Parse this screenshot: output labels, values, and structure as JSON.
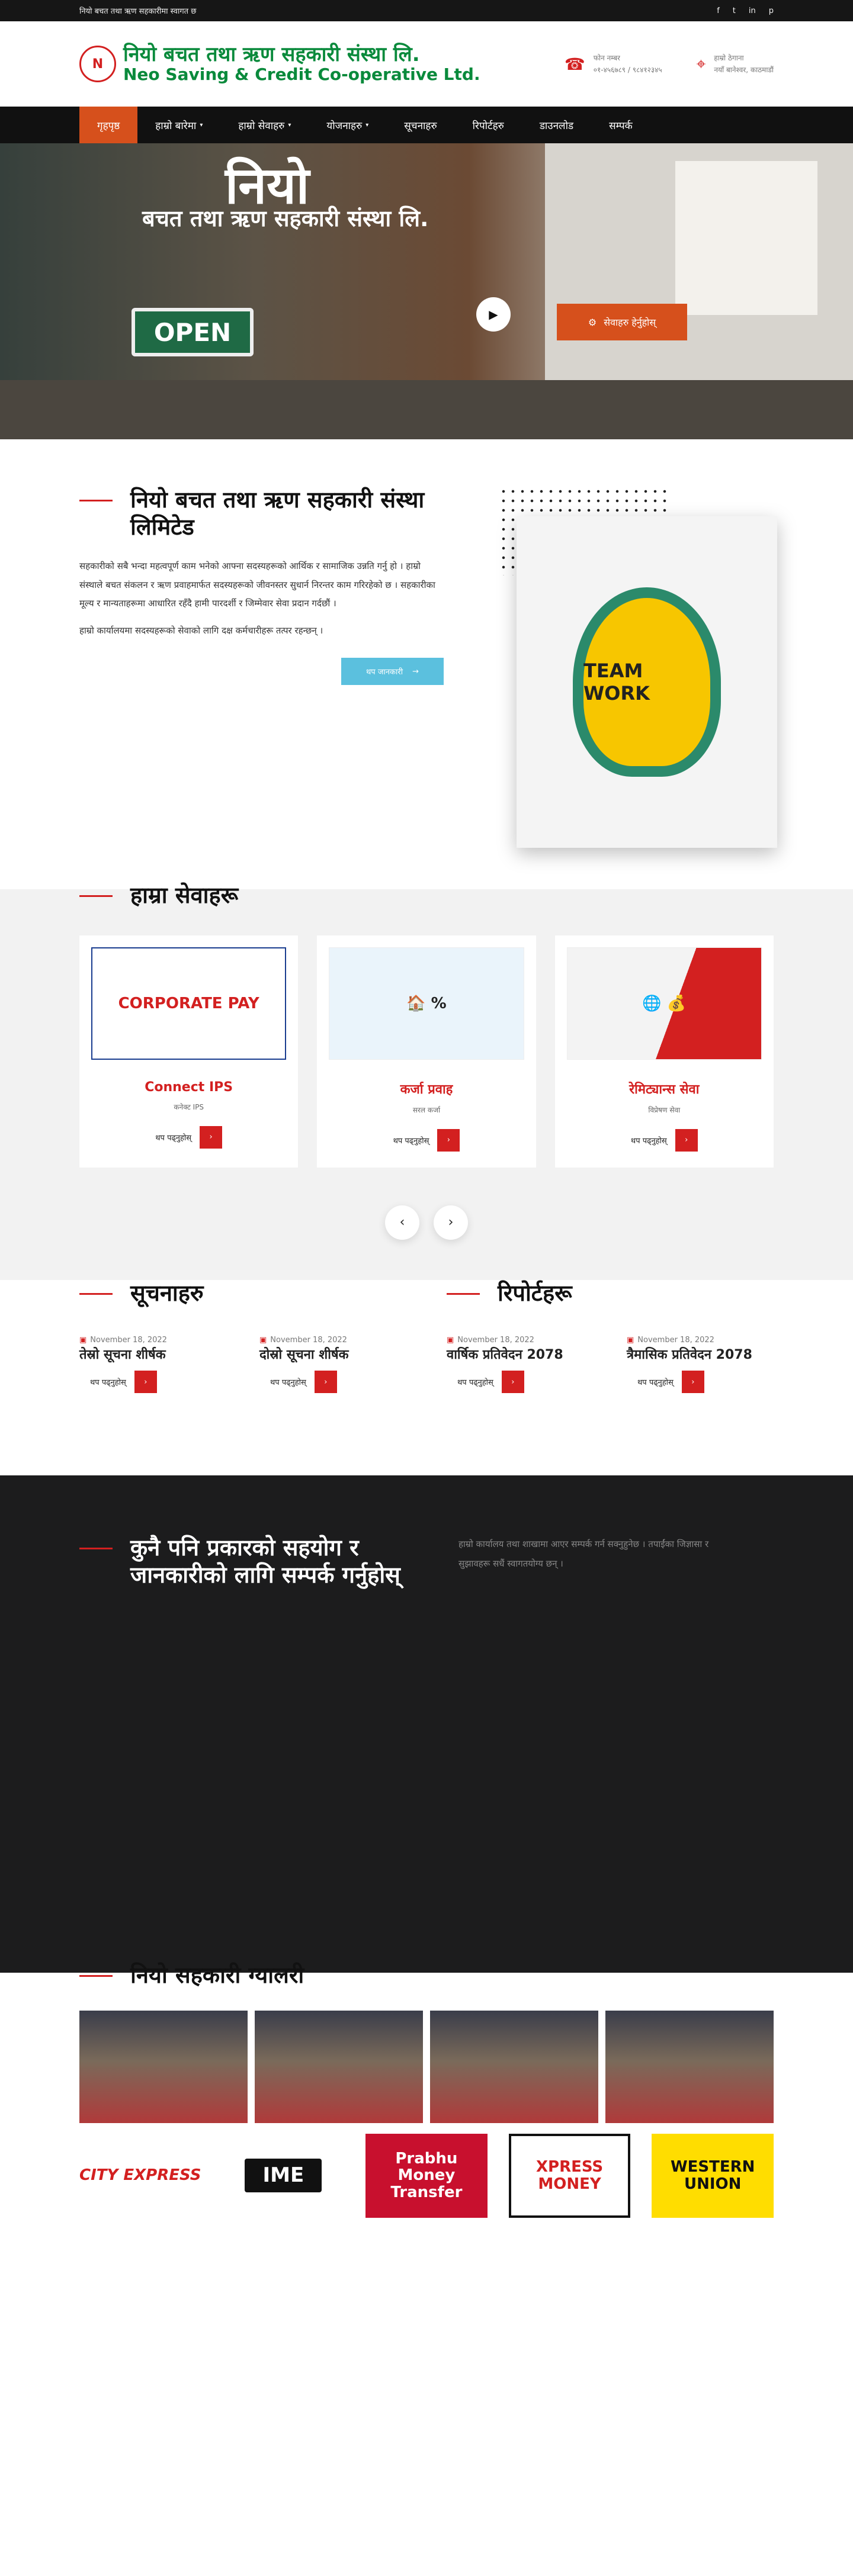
{
  "topbar": {
    "text": "नियो बचत तथा ऋण सहकारीमा स्वागत छ",
    "social": [
      "f",
      "t",
      "in",
      "p"
    ]
  },
  "logo": {
    "mark": "N",
    "line1": "नियो बचत तथा ऋण सहकारी संस्था लि.",
    "line2": "Neo Saving & Credit Co-operative Ltd."
  },
  "contacts": [
    {
      "icon": "phone-icon",
      "glyph": "☎",
      "line1": "फोन नम्बर",
      "line2": "०१-४५६७८९ / ९८४१२३४५"
    },
    {
      "icon": "location-icon",
      "glyph": "⌖",
      "line1": "हाम्रो ठेगाना",
      "line2": "नयाँ बानेश्वर, काठमाडौं"
    }
  ],
  "nav": [
    {
      "label": "गृहपृष्ठ",
      "active": true,
      "caret": ""
    },
    {
      "label": "हाम्रो बारेमा",
      "active": false,
      "caret": "▾"
    },
    {
      "label": "हाम्रो सेवाहरु",
      "active": false,
      "caret": "▾"
    },
    {
      "label": "योजनाहरु",
      "active": false,
      "caret": "▾"
    },
    {
      "label": "सूचनाहरु",
      "active": false,
      "caret": ""
    },
    {
      "label": "रिपोर्टहरु",
      "active": false,
      "caret": ""
    },
    {
      "label": "डाउनलोड",
      "active": false,
      "caret": ""
    },
    {
      "label": "सम्पर्क",
      "active": false,
      "caret": ""
    }
  ],
  "hero": {
    "sign": "नियो",
    "sign2": "बचत तथा ऋण सहकारी संस्था लि.",
    "open": "OPEN",
    "play": "▶",
    "button": "सेवाहरु हेर्नुहोस्",
    "button_icon": "⚙"
  },
  "about": {
    "title": "नियो बचत तथा ऋण सहकारी संस्था लिमिटेड",
    "p1": "सहकारीको सबै भन्दा महत्वपूर्ण काम भनेको आफ्ना सदस्यहरूको आर्थिक र सामाजिक उन्नति गर्नु हो । हाम्रो संस्थाले बचत संकलन र ऋण प्रवाहमार्फत सदस्यहरूको जीवनस्तर सुधार्न निरन्तर काम गरिरहेको छ । सहकारीका मूल्य र मान्यताहरूमा आधारित रहँदै हामी पारदर्शी र जिम्मेवार सेवा प्रदान गर्दछौं ।",
    "p2": "हाम्रो कार्यालयमा सदस्यहरूको सेवाको लागि दक्ष कर्मचारीहरू तत्पर रहन्छन् ।",
    "button": "थप जानकारी",
    "button_icon": "→",
    "image_text": "TEAM WORK"
  },
  "services": {
    "title": "हाम्रा सेवाहरू",
    "items": [
      {
        "name": "Connect IPS",
        "sub": "कनेक्ट IPS",
        "pic": "CORPORATE PAY",
        "rm": "थप पढ्नुहोस्"
      },
      {
        "name": "कर्जा प्रवाह",
        "sub": "सरल कर्जा",
        "pic": "🏠 %",
        "rm": "थप पढ्नुहोस्"
      },
      {
        "name": "रेमिट्यान्स सेवा",
        "sub": "विप्रेषण सेवा",
        "pic": "🌐 💰",
        "rm": "थप पढ्नुहोस्"
      }
    ],
    "prev": "‹",
    "next": "›"
  },
  "notices": {
    "title": "सूचनाहरु",
    "posts": [
      {
        "date": "November 18, 2022",
        "title": "तेस्रो सूचना शीर्षक",
        "rm": "थप पढ्नुहोस्"
      },
      {
        "date": "November 18, 2022",
        "title": "दोस्रो सूचना शीर्षक",
        "rm": "थप पढ्नुहोस्"
      }
    ]
  },
  "reports": {
    "title": "रिपोर्टहरू",
    "posts": [
      {
        "date": "November 18, 2022",
        "title": "वार्षिक प्रतिवेदन 2078",
        "rm": "थप पढ्नुहोस्"
      },
      {
        "date": "November 18, 2022",
        "title": "त्रैमासिक प्रतिवेदन 2078",
        "rm": "थप पढ्नुहोस्"
      }
    ]
  },
  "contact": {
    "title": "कुनै पनि प्रकारको सहयोग र जानकारीको लागि सम्पर्क गर्नुहोस्",
    "text": "हाम्रो कार्यालय तथा शाखामा आएर सम्पर्क गर्न सक्नुहुनेछ । तपाईंका जिज्ञासा र सुझावहरू सधैं स्वागतयोग्य छन् ।"
  },
  "gallery": {
    "title": "नियो सहकारी ग्यालरी",
    "photos": [
      "",
      "",
      "",
      ""
    ],
    "partners": [
      {
        "name": "CITY EXPRESS",
        "bg": "#ffffff",
        "color": "#d32020"
      },
      {
        "name": "IME",
        "bg": "#ffffff",
        "color": "#111111"
      },
      {
        "name": "Prabhu Money Transfer",
        "bg": "#c8102e",
        "color": "#ffffff"
      },
      {
        "name": "XPRESS MONEY",
        "bg": "#ffffff",
        "color": "#d32020"
      },
      {
        "name": "WESTERN UNION",
        "bg": "#ffdd00",
        "color": "#111111"
      }
    ]
  },
  "colors": {
    "accent": "#d32020",
    "nav_active": "#d6501c",
    "brand_green": "#0a8a3c",
    "dark": "#1c1c1d"
  }
}
